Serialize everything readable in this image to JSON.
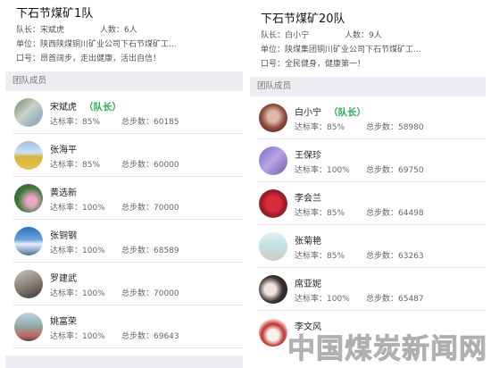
{
  "teams": [
    {
      "name": "下石节煤矿1队",
      "captain_label": "队长：宋斌虎",
      "count_label": "人数：6人",
      "unit_label": "单位：陕西陕煤铜川矿业公司下石节煤矿工...",
      "slogan_label": "口号：昂首阔步，走出健康，活出自信！",
      "section_label": "团队成员",
      "members": [
        {
          "name": "宋斌虎",
          "tag": "（队长）",
          "rate": "达标率：85%",
          "steps": "总步数：60185",
          "avatar": "photo-icon"
        },
        {
          "name": "张海平",
          "tag": "",
          "rate": "达标率：85%",
          "steps": "总步数：60000",
          "avatar": "photo-icon"
        },
        {
          "name": "黄选新",
          "tag": "",
          "rate": "达标率：100%",
          "steps": "总步数：70000",
          "avatar": "photo-icon"
        },
        {
          "name": "张铜钢",
          "tag": "",
          "rate": "达标率：100%",
          "steps": "总步数：68589",
          "avatar": "photo-icon"
        },
        {
          "name": "罗建武",
          "tag": "",
          "rate": "达标率：100%",
          "steps": "总步数：70000",
          "avatar": "photo-icon"
        },
        {
          "name": "姚富荣",
          "tag": "",
          "rate": "达标率：100%",
          "steps": "总步数：69643",
          "avatar": "photo-icon"
        }
      ]
    },
    {
      "name": "下石节煤矿20队",
      "captain_label": "队长：白小宁",
      "count_label": "人数：9人",
      "unit_label": "单位：陕煤集团铜川矿业公司下石节煤矿工...",
      "slogan_label": "口号：全民健身，健康第一！",
      "section_label": "团队成员",
      "members": [
        {
          "name": "白小宁",
          "tag": "（队长）",
          "rate": "达标率：85%",
          "steps": "总步数：58980",
          "avatar": "photo-icon"
        },
        {
          "name": "王保珍",
          "tag": "",
          "rate": "达标率：100%",
          "steps": "总步数：69750",
          "avatar": "photo-icon"
        },
        {
          "name": "李会兰",
          "tag": "",
          "rate": "达标率：85%",
          "steps": "总步数：64498",
          "avatar": "photo-icon"
        },
        {
          "name": "张菊艳",
          "tag": "",
          "rate": "达标率：85%",
          "steps": "总步数：63263",
          "avatar": "photo-icon"
        },
        {
          "name": "席亚妮",
          "tag": "",
          "rate": "达标率：100%",
          "steps": "总步数：65487",
          "avatar": "photo-icon"
        },
        {
          "name": "李文风",
          "tag": "",
          "rate": "",
          "steps": "",
          "avatar": "photo-icon"
        }
      ]
    }
  ],
  "watermark": "中国煤炭新闻网",
  "colors": {
    "leader": "#26b04f",
    "section_bg": "#eceef1"
  }
}
